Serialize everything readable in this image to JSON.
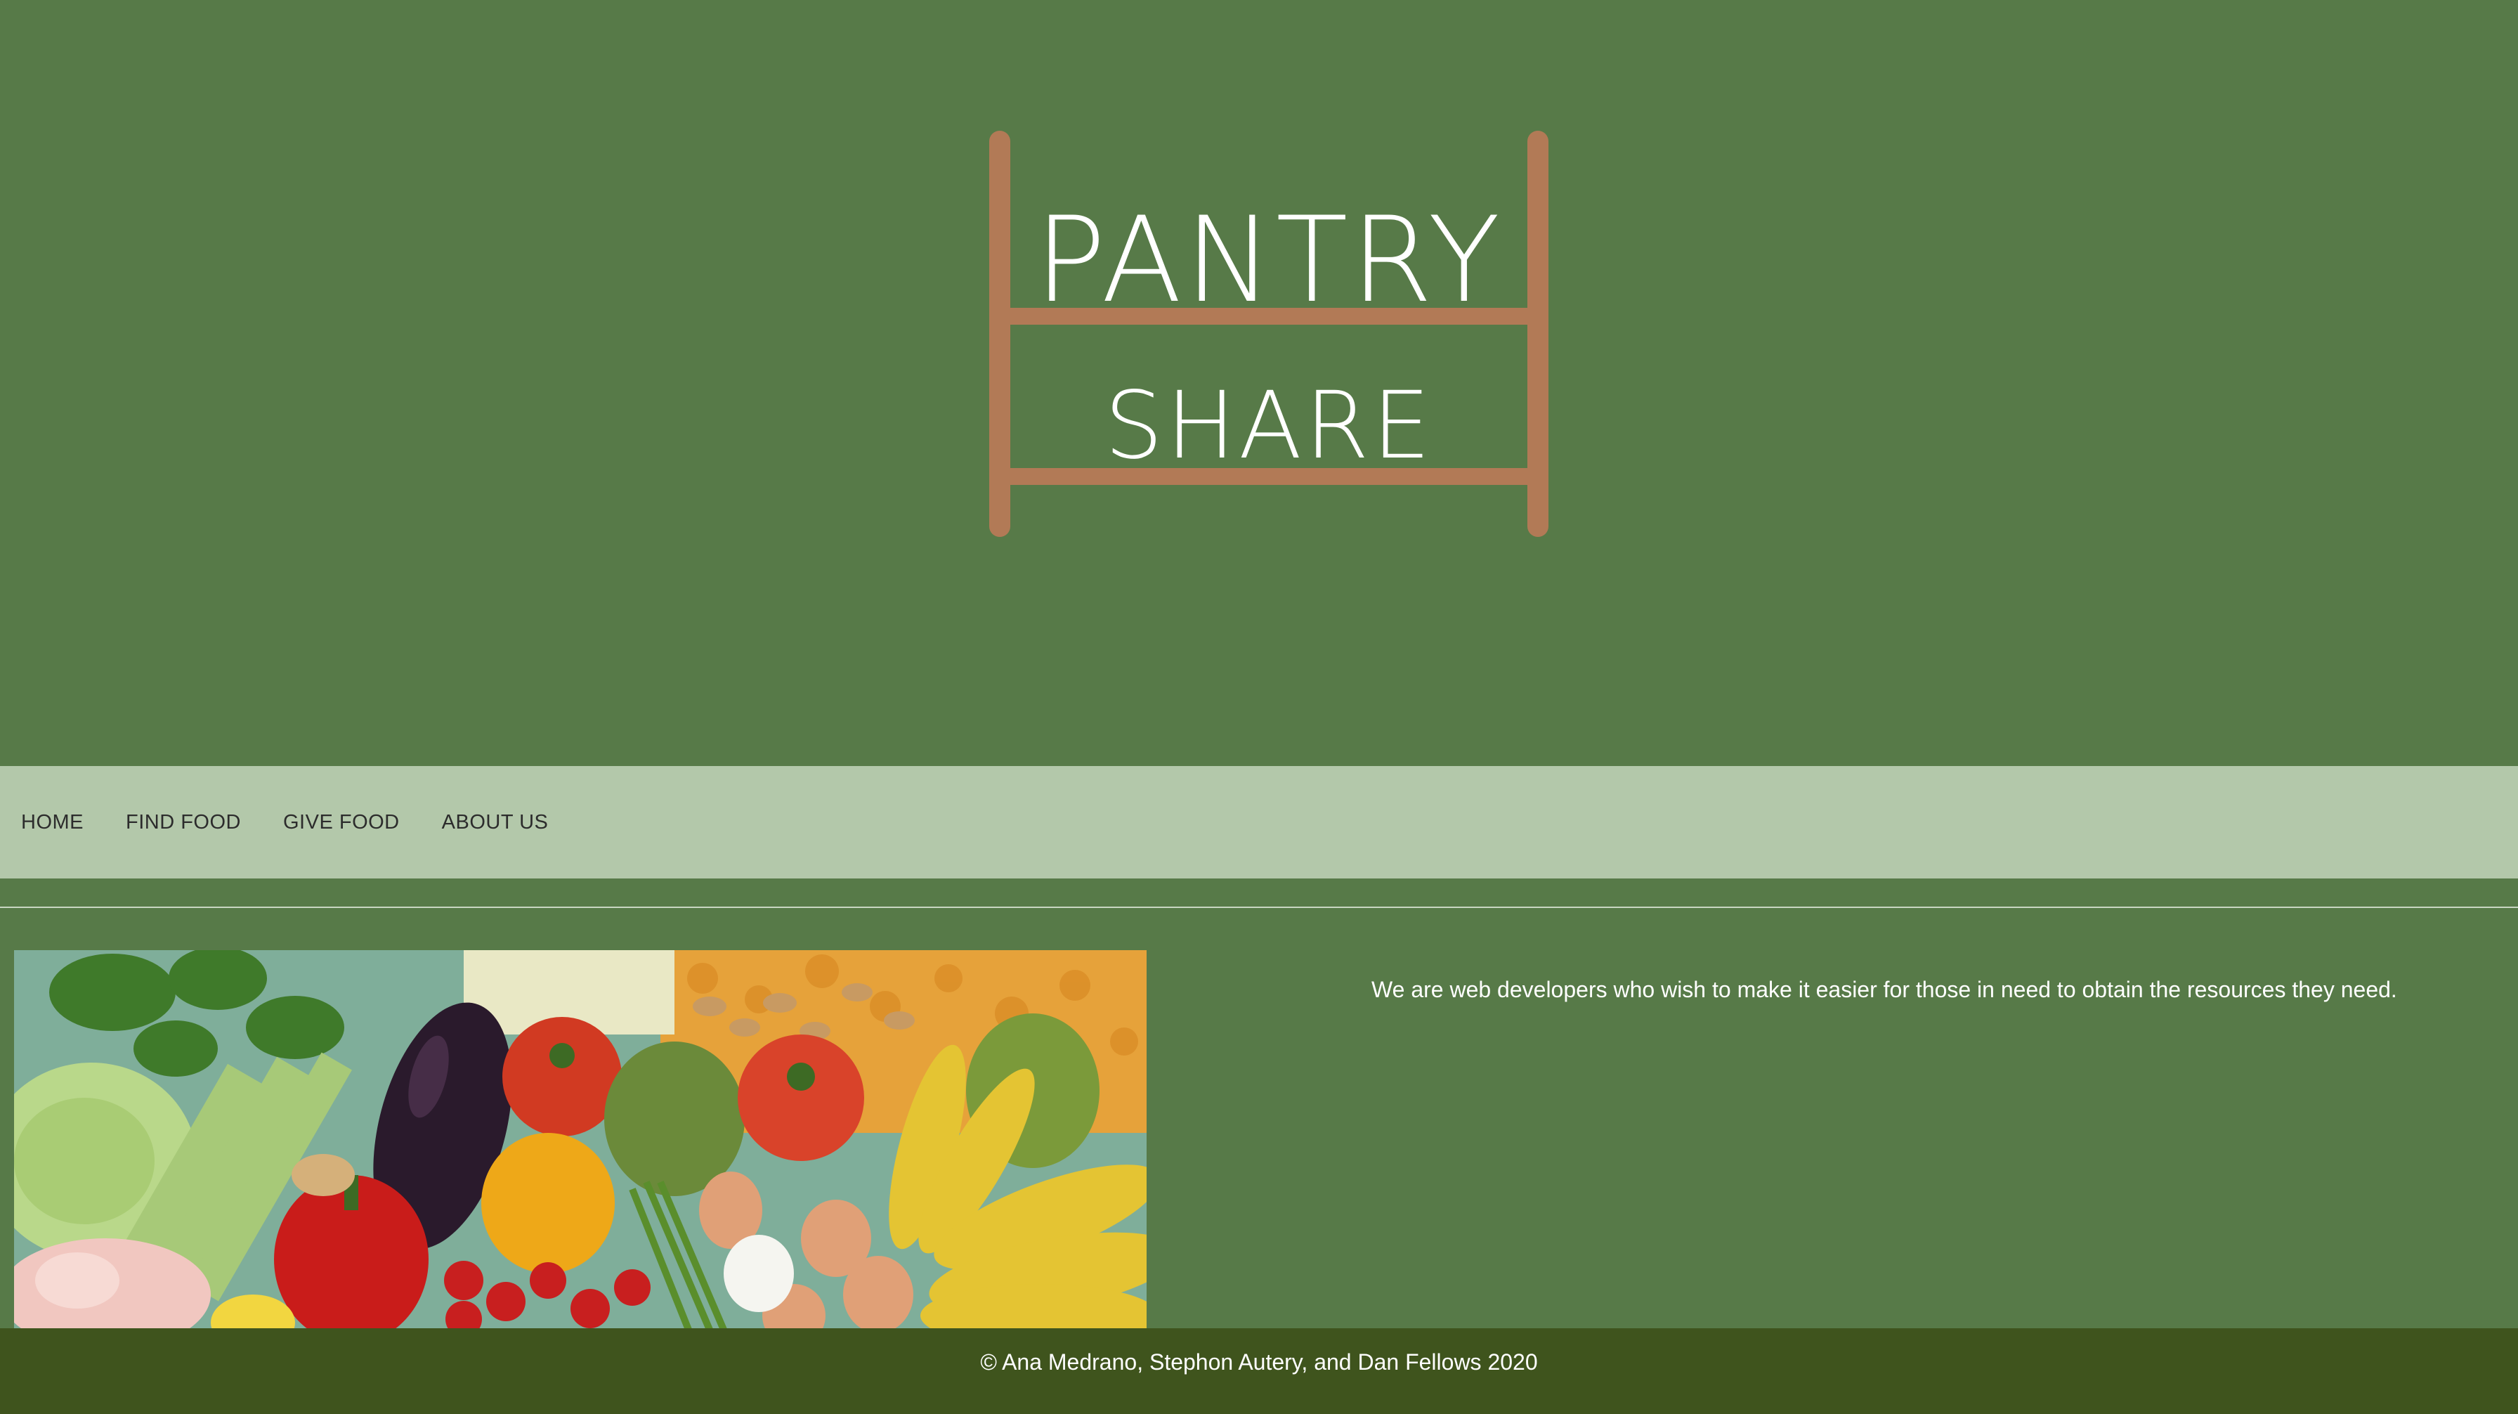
{
  "logo": {
    "line1": "PANTRY",
    "line2": "SHARE",
    "text_color": "#ffffff",
    "shelf_color": "#b27a56"
  },
  "nav": {
    "items": [
      {
        "label": "HOME"
      },
      {
        "label": "FIND FOOD"
      },
      {
        "label": "GIVE FOOD"
      },
      {
        "label": "ABOUT US"
      }
    ]
  },
  "main": {
    "about_text": "We are web developers who wish to make it easier for those in need to obtain the resources they need."
  },
  "footer": {
    "text": "© Ana Medrano, Stephon Autery, and Dan Fellows 2020"
  },
  "colors": {
    "page_bg": "#577a48",
    "nav_bg": "#b3c8aa",
    "footer_bg": "#3f541d"
  }
}
